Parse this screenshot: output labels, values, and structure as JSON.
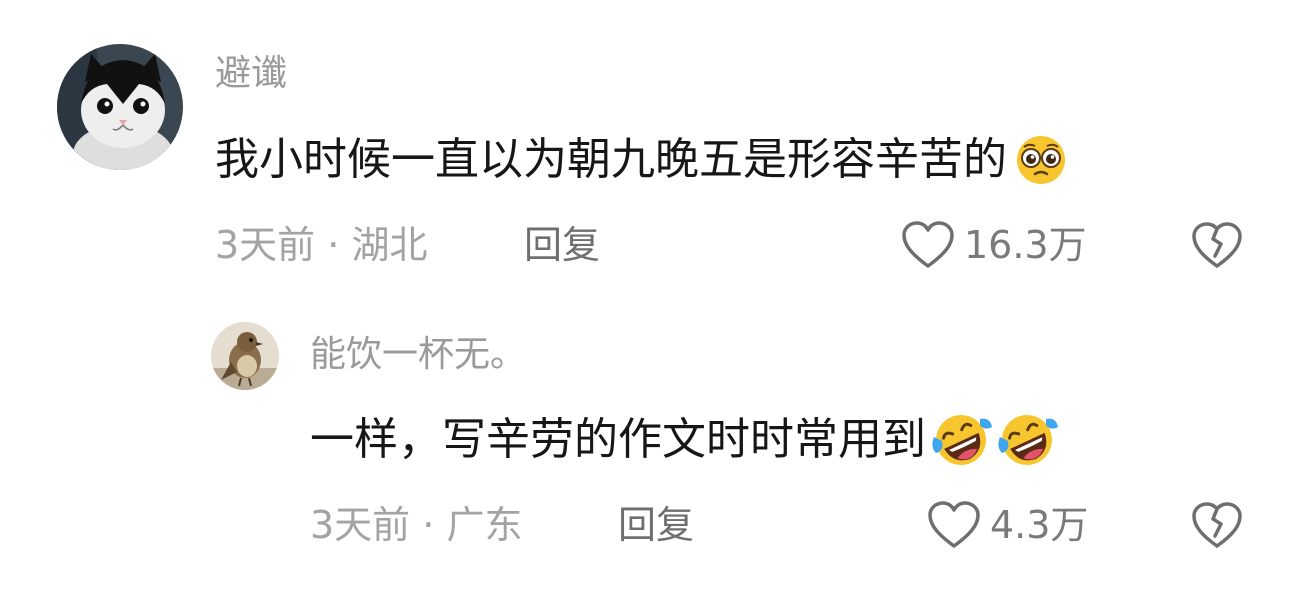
{
  "comments": [
    {
      "username": "避谶",
      "text": "我小时候一直以为朝九晚五是形容辛苦的",
      "emojis": [
        "pleading-face"
      ],
      "time": "3天前",
      "location": "湖北",
      "reply_label": "回复",
      "likes": "16.3万",
      "avatar": "black-and-white-cat"
    },
    {
      "username": "能饮一杯无。",
      "text": "一样，写辛劳的作文时时常用到",
      "emojis": [
        "rolling-on-floor-laughing",
        "rolling-on-floor-laughing"
      ],
      "time": "3天前",
      "location": "广东",
      "reply_label": "回复",
      "likes": "4.3万",
      "avatar": "sparrow"
    }
  ],
  "separator": " · ",
  "colors": {
    "emoji_yellow": "#F7C62E",
    "tear_blue": "#3EA6F0",
    "meta_gray": "#A3A3A3"
  }
}
